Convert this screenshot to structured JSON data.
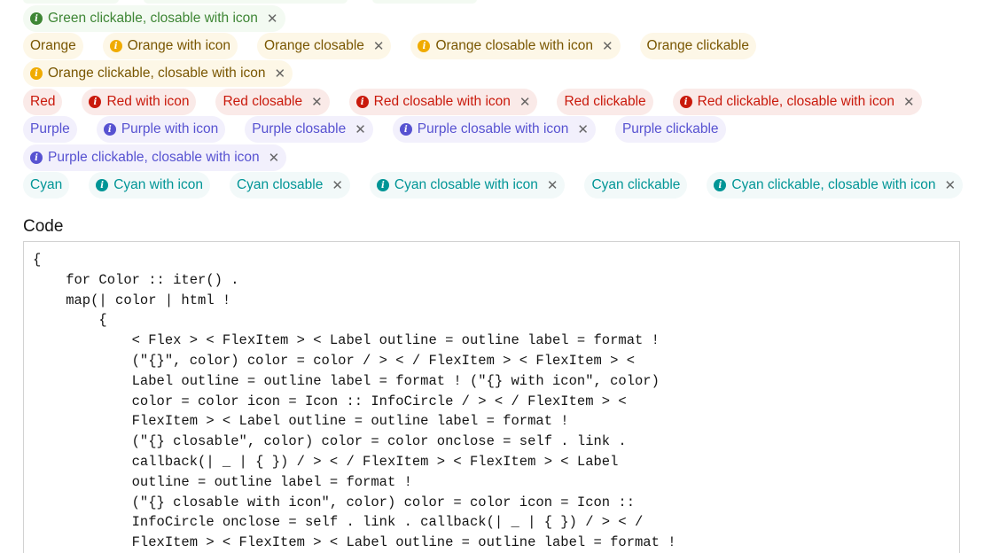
{
  "rows": [
    {
      "row": "green",
      "tags": [
        {
          "label": "Green clickable, closable with icon",
          "color": "green",
          "icon": true,
          "closable": true
        }
      ]
    },
    {
      "row": "orange",
      "tags": [
        {
          "label": "Orange",
          "color": "orange",
          "icon": false,
          "closable": false
        },
        {
          "label": "Orange with icon",
          "color": "orange",
          "icon": true,
          "closable": false
        },
        {
          "label": "Orange closable",
          "color": "orange",
          "icon": false,
          "closable": true
        },
        {
          "label": "Orange closable with icon",
          "color": "orange",
          "icon": true,
          "closable": true
        },
        {
          "label": "Orange clickable",
          "color": "orange",
          "icon": false,
          "closable": false
        }
      ]
    },
    {
      "row": "orange2",
      "tags": [
        {
          "label": "Orange clickable, closable with icon",
          "color": "orange",
          "icon": true,
          "closable": true
        }
      ]
    },
    {
      "row": "red",
      "tags": [
        {
          "label": "Red",
          "color": "red",
          "icon": false,
          "closable": false
        },
        {
          "label": "Red with icon",
          "color": "red",
          "icon": true,
          "closable": false
        },
        {
          "label": "Red closable",
          "color": "red",
          "icon": false,
          "closable": true
        },
        {
          "label": "Red closable with icon",
          "color": "red",
          "icon": true,
          "closable": true
        },
        {
          "label": "Red clickable",
          "color": "red",
          "icon": false,
          "closable": false
        },
        {
          "label": "Red clickable, closable with icon",
          "color": "red",
          "icon": true,
          "closable": true
        }
      ]
    },
    {
      "row": "purple",
      "tags": [
        {
          "label": "Purple",
          "color": "purple",
          "icon": false,
          "closable": false
        },
        {
          "label": "Purple with icon",
          "color": "purple",
          "icon": true,
          "closable": false
        },
        {
          "label": "Purple closable",
          "color": "purple",
          "icon": false,
          "closable": true
        },
        {
          "label": "Purple closable with icon",
          "color": "purple",
          "icon": true,
          "closable": true
        },
        {
          "label": "Purple clickable",
          "color": "purple",
          "icon": false,
          "closable": false
        }
      ]
    },
    {
      "row": "purple2",
      "tags": [
        {
          "label": "Purple clickable, closable with icon",
          "color": "purple",
          "icon": true,
          "closable": true
        }
      ]
    },
    {
      "row": "cyan",
      "tags": [
        {
          "label": "Cyan",
          "color": "cyan",
          "icon": false,
          "closable": false
        },
        {
          "label": "Cyan with icon",
          "color": "cyan",
          "icon": true,
          "closable": false
        },
        {
          "label": "Cyan closable",
          "color": "cyan",
          "icon": false,
          "closable": true
        },
        {
          "label": "Cyan closable with icon",
          "color": "cyan",
          "icon": true,
          "closable": true
        },
        {
          "label": "Cyan clickable",
          "color": "cyan",
          "icon": false,
          "closable": false
        },
        {
          "label": "Cyan clickable, closable with icon",
          "color": "cyan",
          "icon": true,
          "closable": true
        }
      ]
    }
  ],
  "icons": {
    "info": "info-circle-icon",
    "close": "close-icon",
    "info_glyph": "i",
    "close_glyph": "✕"
  },
  "code_section": {
    "heading": "Code",
    "lines": [
      "{",
      "    for Color :: iter() .",
      "    map(| color | html !",
      "        {",
      "            < Flex > < FlexItem > < Label outline = outline label = format !",
      "            (\"{}\", color) color = color / > < / FlexItem > < FlexItem > <",
      "            Label outline = outline label = format ! (\"{} with icon\", color)",
      "            color = color icon = Icon :: InfoCircle / > < / FlexItem > <",
      "            FlexItem > < Label outline = outline label = format !",
      "            (\"{} closable\", color) color = color onclose = self . link .",
      "            callback(| _ | { }) / > < / FlexItem > < FlexItem > < Label",
      "            outline = outline label = format !",
      "            (\"{} closable with icon\", color) color = color icon = Icon ::",
      "            InfoCircle onclose = self . link . callback(| _ | { }) / > < /",
      "            FlexItem > < FlexItem > < Label outline = outline label = format !"
    ]
  }
}
